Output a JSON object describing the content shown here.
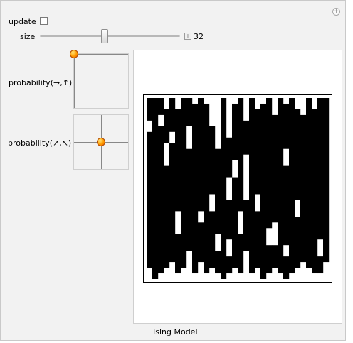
{
  "controls": {
    "update_label": "update",
    "update_checked": false,
    "size_label": "size",
    "size_value": "32",
    "size_fraction": 0.46,
    "prob1_label": "probability(→,↑)",
    "prob2_label": "probability(↗,↖)",
    "prob1_point": [
      0,
      0
    ],
    "prob2_point": [
      0.5,
      0.5
    ]
  },
  "plot": {
    "caption": "Ising Model",
    "rows": 32,
    "cols": 32,
    "colors": {
      "black": "#000000",
      "white": "#ffffff"
    },
    "column_runs": [
      [
        [
          0,
          4
        ],
        [
          6,
          30
        ]
      ],
      [
        [
          0,
          32
        ]
      ],
      [
        [
          0,
          3
        ],
        [
          5,
          31
        ]
      ],
      [
        [
          2,
          8
        ],
        [
          12,
          30
        ]
      ],
      [
        [
          0,
          6
        ],
        [
          8,
          29
        ]
      ],
      [
        [
          2,
          20
        ],
        [
          24,
          31
        ]
      ],
      [
        [
          0,
          30
        ]
      ],
      [
        [
          0,
          5
        ],
        [
          9,
          27
        ]
      ],
      [
        [
          1,
          31
        ]
      ],
      [
        [
          0,
          20
        ],
        [
          22,
          29
        ]
      ],
      [
        [
          1,
          31
        ]
      ],
      [
        [
          5,
          17
        ],
        [
          20,
          30
        ]
      ],
      [
        [
          9,
          24
        ],
        [
          27,
          31
        ]
      ],
      [
        [
          0,
          32
        ]
      ],
      [
        [
          7,
          14
        ],
        [
          18,
          25
        ],
        [
          28,
          31
        ]
      ],
      [
        [
          1,
          11
        ],
        [
          14,
          30
        ]
      ],
      [
        [
          0,
          20
        ],
        [
          24,
          31
        ]
      ],
      [
        [
          4,
          10
        ],
        [
          18,
          27
        ]
      ],
      [
        [
          0,
          31
        ]
      ],
      [
        [
          2,
          17
        ],
        [
          20,
          30
        ]
      ],
      [
        [
          1,
          32
        ]
      ],
      [
        [
          0,
          23
        ],
        [
          26,
          31
        ]
      ],
      [
        [
          3,
          22
        ],
        [
          26,
          30
        ]
      ],
      [
        [
          0,
          31
        ]
      ],
      [
        [
          1,
          9
        ],
        [
          12,
          26
        ],
        [
          28,
          32
        ]
      ],
      [
        [
          0,
          31
        ]
      ],
      [
        [
          2,
          18
        ],
        [
          21,
          30
        ]
      ],
      [
        [
          3,
          29
        ]
      ],
      [
        [
          0,
          30
        ]
      ],
      [
        [
          2,
          31
        ]
      ],
      [
        [
          0,
          25
        ],
        [
          28,
          31
        ]
      ],
      [
        [
          0,
          29
        ]
      ]
    ]
  }
}
